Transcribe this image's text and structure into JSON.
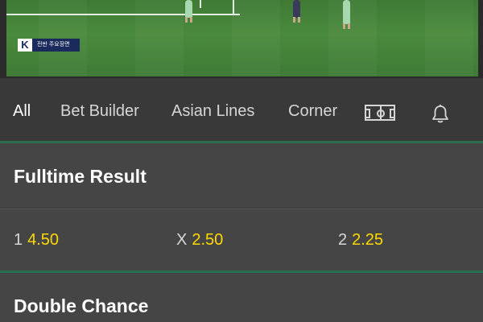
{
  "video": {
    "broadcast_logo": "K",
    "broadcast_caption": "전반 주요장면"
  },
  "tabs": [
    {
      "label": "All",
      "active": true
    },
    {
      "label": "Bet Builder",
      "active": false
    },
    {
      "label": "Asian Lines",
      "active": false
    },
    {
      "label": "Corners",
      "active": false
    }
  ],
  "icons": {
    "pitch": "football-pitch-icon",
    "bell": "bell-icon"
  },
  "markets": [
    {
      "title": "Fulltime Result",
      "odds": [
        {
          "label": "1",
          "price": "4.50"
        },
        {
          "label": "X",
          "price": "2.50"
        },
        {
          "label": "2",
          "price": "2.25"
        }
      ]
    },
    {
      "title": "Double Chance"
    }
  ],
  "colors": {
    "price": "#ffd800",
    "accent_green": "#2c6e52",
    "background": "#3a3a3a",
    "panel": "#454545"
  }
}
